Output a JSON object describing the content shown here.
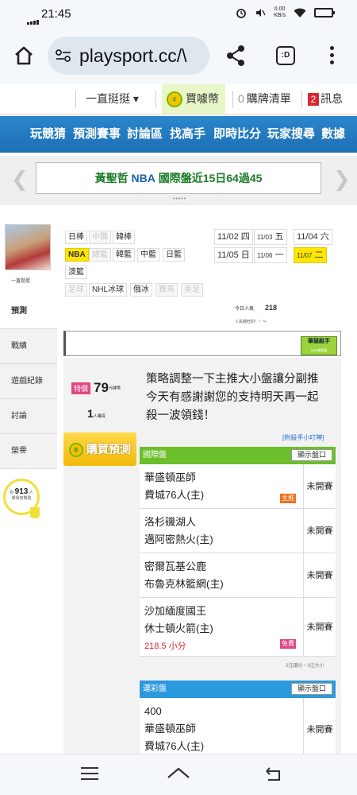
{
  "status": {
    "time": "21:45",
    "net_speed_value": "0.00",
    "net_speed_unit": "KB/s"
  },
  "browser": {
    "url": "playsport.cc/\\",
    "tab_count_label": ":D"
  },
  "userbar": {
    "stand": "一直挺挺 ▾",
    "buy_coin": "買噱幣",
    "purchase_count": "0",
    "purchase_list": "購牌清單",
    "message_count": "2",
    "messages": "訊息"
  },
  "nav": [
    "玩競猜",
    "預測賽事",
    "討論區",
    "找高手",
    "即時比分",
    "玩家搜尋",
    "數據"
  ],
  "banner": {
    "name": "黃聖哲",
    "league": "NBA",
    "text": "國際盤近15日64過45",
    "dots": "•••••"
  },
  "profile": {
    "nickname": "一直挺挺",
    "menu": [
      "預測",
      "戰績",
      "遊戲紀錄",
      "討論",
      "榮譽"
    ],
    "likes": {
      "prefix": "有",
      "count": "913",
      "suffix": "人",
      "line2": "覺得有幫助"
    },
    "leagues": [
      [
        "日棒",
        "中職",
        "韓棒"
      ],
      [
        "NBA",
        "緯籃",
        "韓籃",
        "中籃",
        "日籃"
      ],
      [
        "澳籃"
      ],
      [
        "足球",
        "NHL冰球",
        "俄冰",
        "賽馬",
        "美足"
      ]
    ],
    "dates": [
      {
        "date": "11/02",
        "day": "四"
      },
      {
        "date": "11/03",
        "day": "五"
      },
      {
        "date": "11/04",
        "day": "六"
      },
      {
        "date": "11/05",
        "day": "日"
      },
      {
        "date": "11/06",
        "day": "一"
      },
      {
        "date": "11/07",
        "day": "二"
      }
    ],
    "popularity_label": "今日人氣",
    "popularity_value": "218",
    "popularity_sub": "人氣越旺的！！～",
    "killer_badge": "華猫殺手",
    "killer_badge_sub": "NBA國際盤"
  },
  "prediction": {
    "special_label": "特價",
    "price": "79",
    "price_unit": "元噱幣",
    "buyers": "1",
    "buyers_unit": "人購買",
    "message": "策略調整一下主推大小盤讓分副推 今天有感謝謝您的支持明天再一起 殺一波領錢！",
    "buy_button": "購買預測",
    "helper_link": "[附殺手小叮嚀]",
    "footnote": "2注讓分・3注大小"
  },
  "markets": [
    {
      "name": "國際盤",
      "show_label": "顯示盤口",
      "color": "#6cbf2a",
      "games": [
        {
          "team1": "華盛頓巫師",
          "team2": "費城76人(主)",
          "status": "未開賽",
          "mark": "主推"
        },
        {
          "team1": "洛杉磯湖人",
          "team2": "邁阿密熱火(主)",
          "status": "未開賽"
        },
        {
          "team1": "密爾瓦基公鹿",
          "team2": "布魯克林籃網(主)",
          "status": "未開賽"
        },
        {
          "team1": "沙加緬度國王",
          "team2": "休士頓火箭(主)",
          "status": "未開賽",
          "mark": "免費",
          "score": "218.5 小分"
        }
      ]
    },
    {
      "name": "運彩盤",
      "show_label": "顯示盤口",
      "color": "#2b99dd",
      "games": [
        {
          "code": "400",
          "team1": "華盛頓巫師",
          "team2": "費城76人(主)",
          "status": "未開賽"
        }
      ]
    }
  ]
}
